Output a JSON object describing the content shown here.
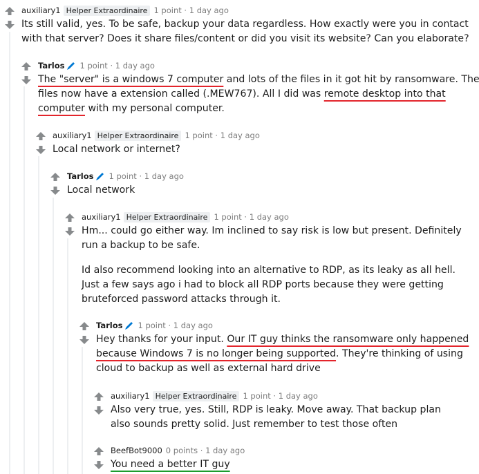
{
  "comments": [
    {
      "user": "auxiliary1",
      "flair": "Helper Extraordinaire",
      "points": "1 point",
      "dot": "·",
      "time": "1 day ago",
      "p1": "Its still valid, yes. To be safe, backup your data regardless. How exactly were you in contact with that server? Does it share files/content or did you visit its website? Can you elaborate?"
    },
    {
      "user": "Tarlos",
      "points": "1 point",
      "dot": "·",
      "time": "1 day ago",
      "p1_hl": "The \"server\" is a windows 7 computer",
      "p1_mid": " and lots of the files in it got hit by ransomware. The files now have a extension called (.MEW767). All I did was ",
      "p1_hl2": "remote desktop into that computer",
      "p1_end": " with my personal computer."
    },
    {
      "user": "auxiliary1",
      "flair": "Helper Extraordinaire",
      "points": "1 point",
      "dot": "·",
      "time": "1 day ago",
      "p1": "Local network or internet?"
    },
    {
      "user": "Tarlos",
      "points": "1 point",
      "dot": "·",
      "time": "1 day ago",
      "p1": "Local network"
    },
    {
      "user": "auxiliary1",
      "flair": "Helper Extraordinaire",
      "points": "1 point",
      "dot": "·",
      "time": "1 day ago",
      "p1": "Hm... could go either way. Im inclined to say risk is low but present. Definitely run a backup to be safe.",
      "p2": "Id also recommend looking into an alternative to RDP, as its leaky as all hell. Just a few says ago i had to block all RDP ports because they were getting bruteforced password attacks through it."
    },
    {
      "user": "Tarlos",
      "points": "1 point",
      "dot": "·",
      "time": "1 day ago",
      "p1_pre": "Hey thanks for your input. ",
      "p1_hl": "Our IT guy thinks the ransomware only happened because Windows 7 is no longer being supported",
      "p1_end": ". They're thinking of using cloud to backup as well as external hard drive"
    },
    {
      "user": "auxiliary1",
      "flair": "Helper Extraordinaire",
      "points": "1 point",
      "dot": "·",
      "time": "1 day ago",
      "p1": "Also very true, yes. Still, RDP is leaky. Move away. That backup plan also sounds pretty solid. Just remember to test those often"
    },
    {
      "user": "BeefBot9000",
      "points": "0 points",
      "dot": "·",
      "time": "1 day ago",
      "p1_hl": "You need a better IT guy"
    }
  ],
  "colors": {
    "highlight_red": "#e3242b",
    "highlight_green": "#1b9c2e",
    "vote_arrow": "#878a8c",
    "thread_line": "#edeff1",
    "pencil": "#0079d3"
  },
  "icons": {
    "upvote": "upvote-arrow-icon",
    "downvote": "downvote-arrow-icon",
    "edit": "pencil-icon"
  }
}
